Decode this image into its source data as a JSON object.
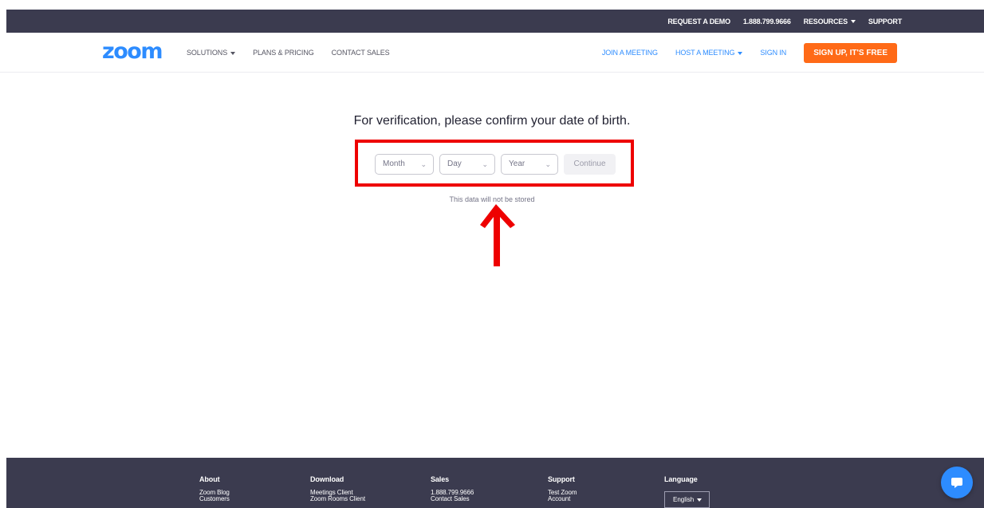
{
  "topbar": {
    "request_demo": "REQUEST A DEMO",
    "phone": "1.888.799.9666",
    "resources": "RESOURCES",
    "support": "SUPPORT"
  },
  "nav": {
    "logo": "zoom",
    "solutions": "SOLUTIONS",
    "plans": "PLANS & PRICING",
    "contact_sales": "CONTACT SALES",
    "join": "JOIN A MEETING",
    "host": "HOST A MEETING",
    "sign_in": "SIGN IN",
    "sign_up": "SIGN UP, IT'S FREE"
  },
  "verification": {
    "heading": "For verification, please confirm your date of birth.",
    "month_placeholder": "Month",
    "day_placeholder": "Day",
    "year_placeholder": "Year",
    "continue": "Continue",
    "note": "This data will not be stored"
  },
  "footer": {
    "columns": [
      {
        "heading": "About",
        "items": [
          "Zoom Blog",
          "Customers"
        ]
      },
      {
        "heading": "Download",
        "items": [
          "Meetings Client",
          "Zoom Rooms Client"
        ]
      },
      {
        "heading": "Sales",
        "items": [
          "1.888.799.9666",
          "Contact Sales"
        ]
      },
      {
        "heading": "Support",
        "items": [
          "Test Zoom",
          "Account"
        ]
      },
      {
        "heading": "Language",
        "items": []
      }
    ],
    "language_selected": "English"
  },
  "colors": {
    "brand_blue": "#2d8cff",
    "signup_orange": "#ff6a17",
    "dark_bar": "#3b3b4f",
    "highlight_red": "#ee0000"
  },
  "icons": {
    "chat": "chat-bubble-icon",
    "dropdown": "chevron-down-icon",
    "annotation": "arrow-up-icon"
  }
}
